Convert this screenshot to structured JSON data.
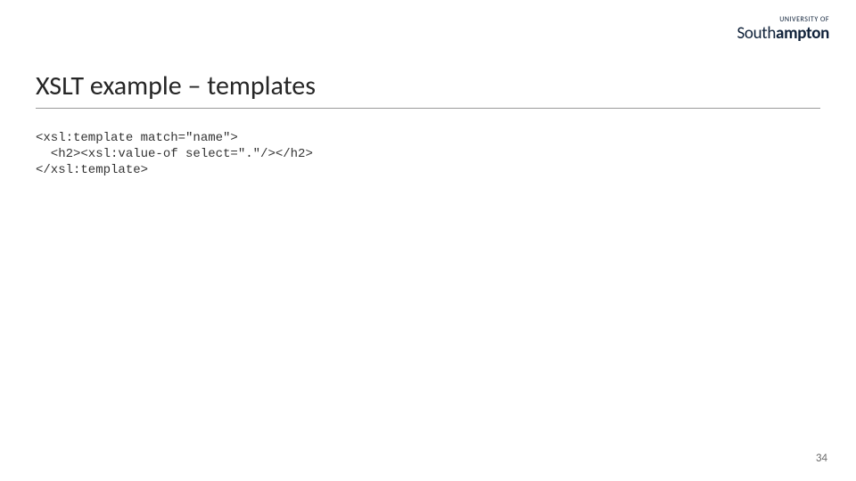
{
  "logo": {
    "upper": "UNIVERSITY OF",
    "mainLight": "South",
    "mainBold": "ampton"
  },
  "title": "XSLT example – templates",
  "code": {
    "line1": "<xsl:template match=\"name\">",
    "line2": "  <h2><xsl:value-of select=\".\"/></h2>",
    "line3": "</xsl:template>"
  },
  "pageNumber": "34"
}
